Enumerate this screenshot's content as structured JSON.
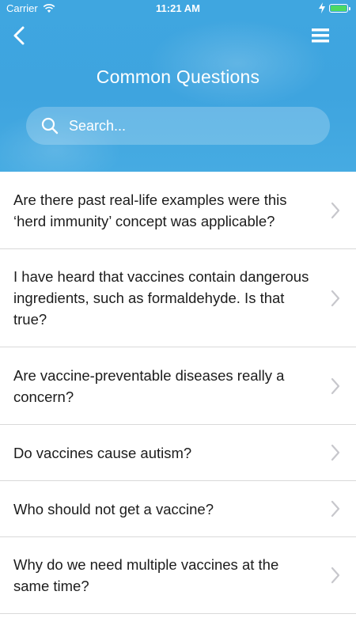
{
  "status_bar": {
    "carrier": "Carrier",
    "time": "11:21 AM"
  },
  "header": {
    "title": "Common Questions",
    "search_placeholder": "Search..."
  },
  "questions": [
    {
      "text": "Are there past real-life examples were this ‘herd immunity’ concept was applicable?"
    },
    {
      "text": "I have heard that vaccines contain dangerous ingredients, such as formaldehyde. Is that true?"
    },
    {
      "text": "Are vaccine-preventable diseases really a concern?"
    },
    {
      "text": "Do vaccines cause autism?"
    },
    {
      "text": "Who should not get a vaccine?"
    },
    {
      "text": "Why do we need multiple vaccines at the same time?"
    }
  ],
  "icons": {
    "back": "chevron-left-icon",
    "menu": "hamburger-menu-icon",
    "search": "search-icon",
    "row_disclosure": "chevron-right-icon"
  },
  "colors": {
    "header_blue": "#3fa6e0",
    "battery_green": "#4cd964",
    "chevron_gray": "#c7c7cc"
  }
}
